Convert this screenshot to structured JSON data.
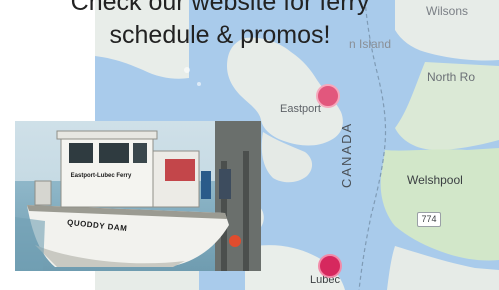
{
  "slide": {
    "headline_line1": "Check our website for ferry",
    "headline_line2": "schedule & promos!"
  },
  "map": {
    "labels": {
      "wilsons": "Wilsons",
      "island": "n Island",
      "north_rd": "North Ro",
      "eastport": "Eastport",
      "welshpool": "Welshpool",
      "canada": "CANADA",
      "lubec": "Lubec"
    },
    "route_shield": "774",
    "pins": [
      {
        "name": "Eastport",
        "color": "#e2577d"
      },
      {
        "name": "Lubec",
        "color": "#d6285e"
      }
    ],
    "colors": {
      "water": "#a7c9ea",
      "land": "#e8ede9",
      "forest": "#cfe6c6",
      "border_line": "#7d9bb6"
    }
  },
  "photo": {
    "sign_text": "Eastport-Lubec Ferry",
    "boat_name": "QUODDY DAM"
  }
}
